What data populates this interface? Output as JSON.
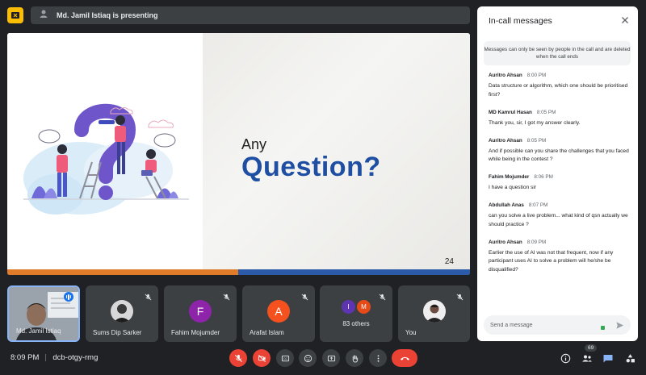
{
  "presenting": {
    "text": "Md. Jamil Istiaq is presenting"
  },
  "slide": {
    "line1": "Any",
    "line2": "Question?",
    "page_number": "24"
  },
  "participants": [
    {
      "name": "Md. Jamil Istiaq",
      "speaking": true
    },
    {
      "name": "Sums Dip Sarker",
      "muted": true
    },
    {
      "name": "Fahim Mojumder",
      "initial": "F",
      "color": "#8e24aa",
      "muted": true
    },
    {
      "name": "Arafat Islam",
      "initial": "A",
      "color": "#f4511e",
      "muted": true
    },
    {
      "name": "83 others",
      "initials": [
        "I",
        "M"
      ],
      "colors": [
        "#5e35b1",
        "#e64a19"
      ],
      "muted": true
    },
    {
      "name": "You",
      "muted": true
    }
  ],
  "meeting": {
    "time": "8:09 PM",
    "code": "dcb-otgy-rmg",
    "participant_count": "69"
  },
  "chat": {
    "title": "In-call messages",
    "notice": "Messages can only be seen by people in the call and are deleted when the call ends",
    "messages": [
      {
        "sender": "Auritro Ahsan",
        "time": "8:00 PM",
        "text": "Data structure or algorithm, which one should be prioritised first?"
      },
      {
        "sender": "MD Kamrul Hasan",
        "time": "8:05 PM",
        "text": "Thank you, sir, I got my answer clearly."
      },
      {
        "sender": "Auritro Ahsan",
        "time": "8:05 PM",
        "text": "And if possible can you share the challenges that you faced while being in the contest ?"
      },
      {
        "sender": "Fahim Mojumder",
        "time": "8:06 PM",
        "text": "I have a question sir"
      },
      {
        "sender": "Abdullah Anas",
        "time": "8:07 PM",
        "text": "can you solve a live problem... what kind of qsn actually we should practice ?"
      },
      {
        "sender": "Auritro Ahsan",
        "time": "8:09 PM",
        "text": "Earlier the use of AI was not that frequent, now if any participant uses AI to solve a problem will he/she be disqualified?"
      }
    ],
    "input_placeholder": "Send a message"
  },
  "icons": {
    "mic": "mic-off-icon",
    "camera": "camera-off-icon",
    "captions": "closed-captions-icon",
    "emoji": "emoji-icon",
    "present": "present-screen-icon",
    "hand": "raise-hand-icon",
    "more": "more-vert-icon",
    "end": "end-call-icon",
    "info": "info-icon",
    "people": "people-icon",
    "chat": "chat-icon",
    "activities": "activities-icon"
  }
}
